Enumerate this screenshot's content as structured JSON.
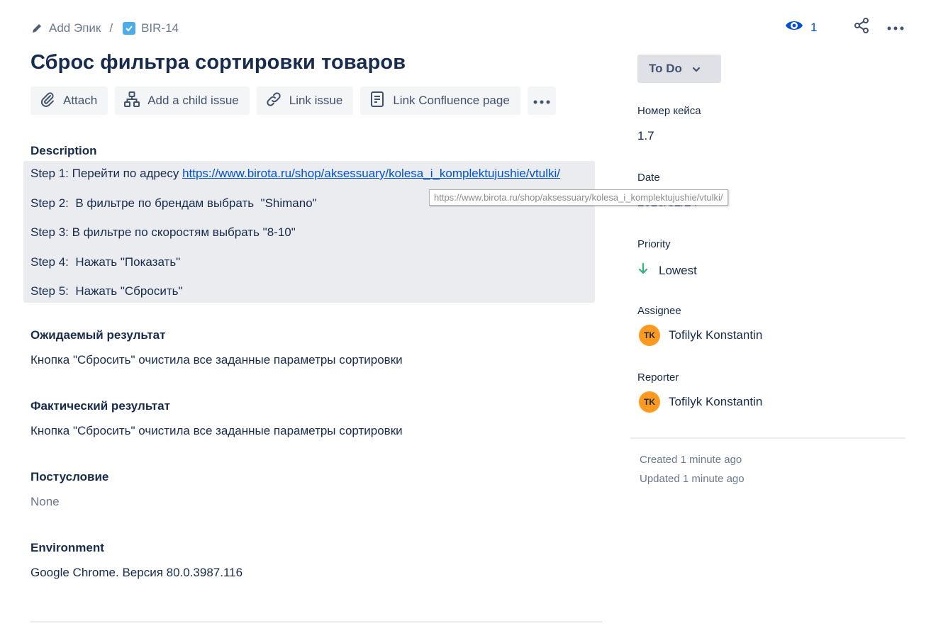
{
  "breadcrumb": {
    "parent_label": "Add Эпик",
    "separator": "/",
    "issue_key": "BIR-14"
  },
  "top_actions": {
    "watch_count": "1"
  },
  "issue": {
    "title": "Сброс фильтра сортировки товаров"
  },
  "toolbar": {
    "attach_label": "Attach",
    "child_issue_label": "Add a child issue",
    "link_issue_label": "Link issue",
    "confluence_label": "Link Confluence page"
  },
  "description": {
    "label": "Description",
    "step1_prefix": "Step 1: Перейти по адресу ",
    "step1_link": "https://www.birota.ru/shop/aksessuary/kolesa_i_komplektujushie/vtulki/",
    "step2": "Step 2:  В фильтре по брендам выбрать  \"Shimano\"",
    "step3": "Step 3: В фильтре по скоростям выбрать \"8-10\"",
    "step4": "Step 4:  Нажать \"Показать\"",
    "step5": "Step 5:  Нажать \"Сбросить\"",
    "tooltip": "https://www.birota.ru/shop/aksessuary/kolesa_i_komplektujushie/vtulki/"
  },
  "fields": {
    "expected_label": "Ожидаемый результат",
    "expected_value": "Кнопка \"Сбросить\" очистила все заданные параметры сортировки",
    "actual_label": "Фактический результат",
    "actual_value": "Кнопка \"Сбросить\" очистила все заданные параметры сортировки",
    "postcondition_label": "Постусловие",
    "postcondition_value": "None",
    "environment_label": "Environment",
    "environment_value": "Google Chrome. Версия 80.0.3987.116"
  },
  "sidebar": {
    "status": "To Do",
    "case_number_label": "Номер кейса",
    "case_number_value": "1.7",
    "date_label": "Date",
    "date_value": "2020/02/24",
    "priority_label": "Priority",
    "priority_value": "Lowest",
    "assignee_label": "Assignee",
    "assignee_initials": "TK",
    "assignee_name": "Tofilyk Konstantin",
    "reporter_label": "Reporter",
    "reporter_initials": "TK",
    "reporter_name": "Tofilyk Konstantin",
    "created": "Created 1 minute ago",
    "updated": "Updated 1 minute ago"
  },
  "colors": {
    "link": "#0052cc",
    "avatar": "#ff991f",
    "priority_lowest": "#36b37e",
    "issue_type": "#4bade8"
  },
  "icons": [
    "pencil-icon",
    "checkbox-icon",
    "eye-icon",
    "share-icon",
    "more-icon",
    "paperclip-icon",
    "hierarchy-icon",
    "link-icon",
    "document-icon",
    "chevron-down-icon",
    "arrow-down-icon"
  ]
}
